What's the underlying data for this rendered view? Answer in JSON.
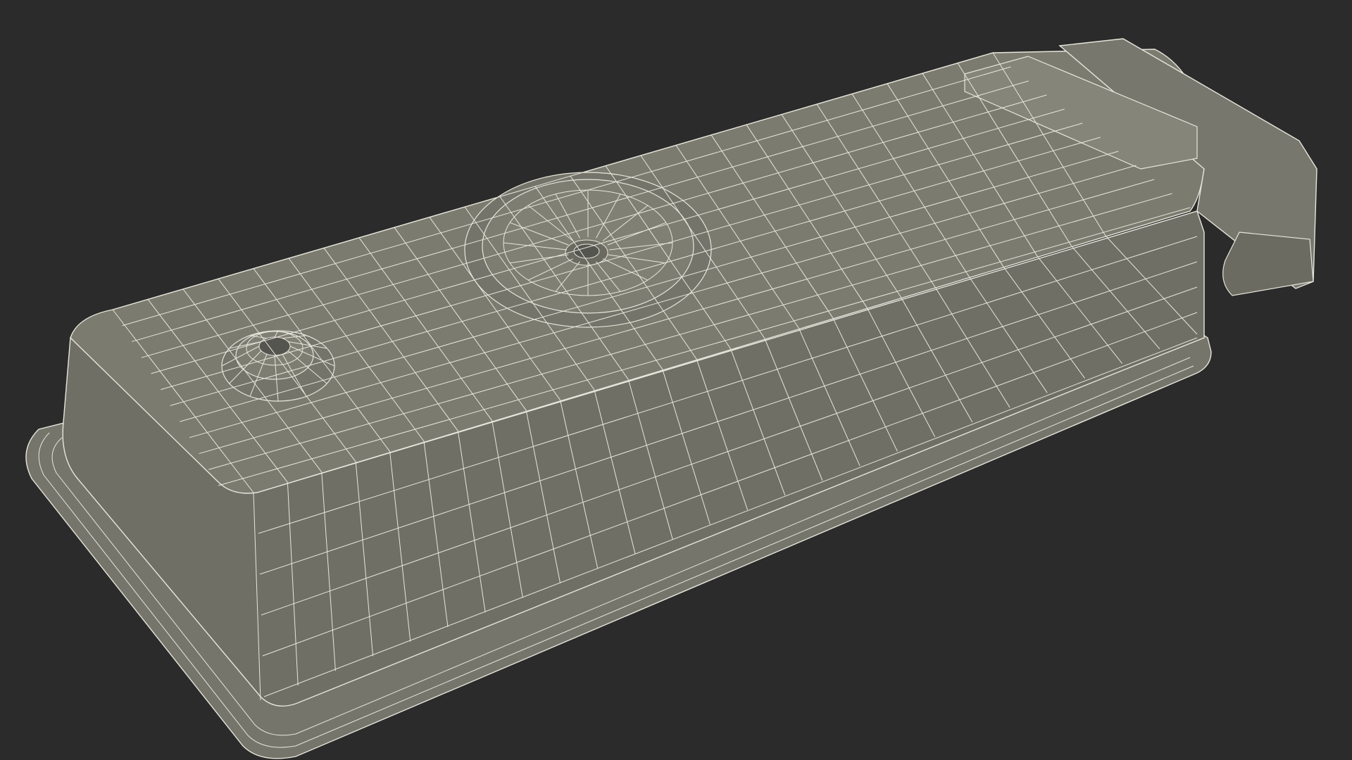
{
  "scene": {
    "background_color": "#2b2b2b",
    "model_fill_top": "#7b7b70",
    "model_fill_side": "#6f6f65",
    "model_fill_flange": "#75756b",
    "wire_color": "#e6e6dc",
    "shadow_color": "#55554d"
  }
}
